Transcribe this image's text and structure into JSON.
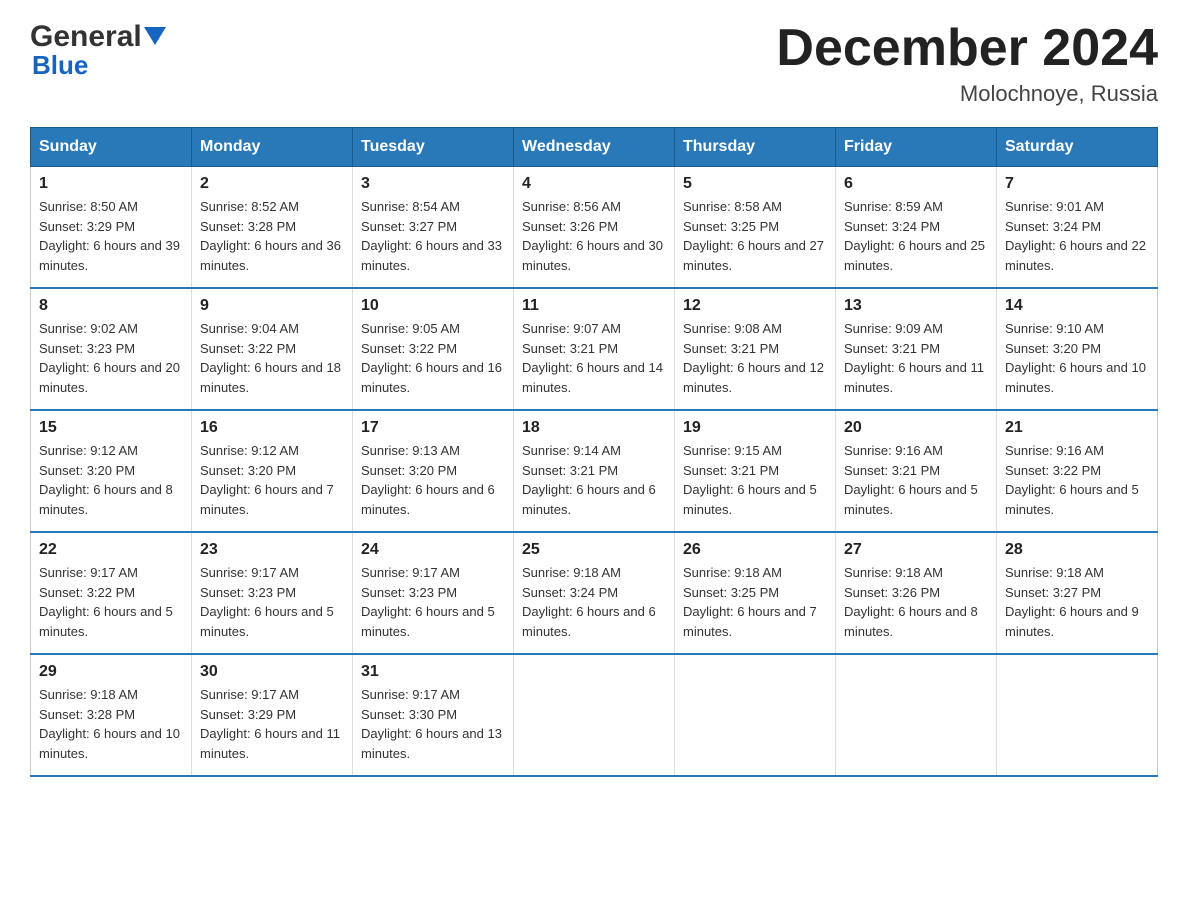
{
  "header": {
    "logo_line1": "General",
    "logo_line2": "Blue",
    "title": "December 2024",
    "subtitle": "Molochnoye, Russia"
  },
  "days_of_week": [
    "Sunday",
    "Monday",
    "Tuesday",
    "Wednesday",
    "Thursday",
    "Friday",
    "Saturday"
  ],
  "weeks": [
    [
      {
        "day": "1",
        "sunrise": "Sunrise: 8:50 AM",
        "sunset": "Sunset: 3:29 PM",
        "daylight": "Daylight: 6 hours and 39 minutes."
      },
      {
        "day": "2",
        "sunrise": "Sunrise: 8:52 AM",
        "sunset": "Sunset: 3:28 PM",
        "daylight": "Daylight: 6 hours and 36 minutes."
      },
      {
        "day": "3",
        "sunrise": "Sunrise: 8:54 AM",
        "sunset": "Sunset: 3:27 PM",
        "daylight": "Daylight: 6 hours and 33 minutes."
      },
      {
        "day": "4",
        "sunrise": "Sunrise: 8:56 AM",
        "sunset": "Sunset: 3:26 PM",
        "daylight": "Daylight: 6 hours and 30 minutes."
      },
      {
        "day": "5",
        "sunrise": "Sunrise: 8:58 AM",
        "sunset": "Sunset: 3:25 PM",
        "daylight": "Daylight: 6 hours and 27 minutes."
      },
      {
        "day": "6",
        "sunrise": "Sunrise: 8:59 AM",
        "sunset": "Sunset: 3:24 PM",
        "daylight": "Daylight: 6 hours and 25 minutes."
      },
      {
        "day": "7",
        "sunrise": "Sunrise: 9:01 AM",
        "sunset": "Sunset: 3:24 PM",
        "daylight": "Daylight: 6 hours and 22 minutes."
      }
    ],
    [
      {
        "day": "8",
        "sunrise": "Sunrise: 9:02 AM",
        "sunset": "Sunset: 3:23 PM",
        "daylight": "Daylight: 6 hours and 20 minutes."
      },
      {
        "day": "9",
        "sunrise": "Sunrise: 9:04 AM",
        "sunset": "Sunset: 3:22 PM",
        "daylight": "Daylight: 6 hours and 18 minutes."
      },
      {
        "day": "10",
        "sunrise": "Sunrise: 9:05 AM",
        "sunset": "Sunset: 3:22 PM",
        "daylight": "Daylight: 6 hours and 16 minutes."
      },
      {
        "day": "11",
        "sunrise": "Sunrise: 9:07 AM",
        "sunset": "Sunset: 3:21 PM",
        "daylight": "Daylight: 6 hours and 14 minutes."
      },
      {
        "day": "12",
        "sunrise": "Sunrise: 9:08 AM",
        "sunset": "Sunset: 3:21 PM",
        "daylight": "Daylight: 6 hours and 12 minutes."
      },
      {
        "day": "13",
        "sunrise": "Sunrise: 9:09 AM",
        "sunset": "Sunset: 3:21 PM",
        "daylight": "Daylight: 6 hours and 11 minutes."
      },
      {
        "day": "14",
        "sunrise": "Sunrise: 9:10 AM",
        "sunset": "Sunset: 3:20 PM",
        "daylight": "Daylight: 6 hours and 10 minutes."
      }
    ],
    [
      {
        "day": "15",
        "sunrise": "Sunrise: 9:12 AM",
        "sunset": "Sunset: 3:20 PM",
        "daylight": "Daylight: 6 hours and 8 minutes."
      },
      {
        "day": "16",
        "sunrise": "Sunrise: 9:12 AM",
        "sunset": "Sunset: 3:20 PM",
        "daylight": "Daylight: 6 hours and 7 minutes."
      },
      {
        "day": "17",
        "sunrise": "Sunrise: 9:13 AM",
        "sunset": "Sunset: 3:20 PM",
        "daylight": "Daylight: 6 hours and 6 minutes."
      },
      {
        "day": "18",
        "sunrise": "Sunrise: 9:14 AM",
        "sunset": "Sunset: 3:21 PM",
        "daylight": "Daylight: 6 hours and 6 minutes."
      },
      {
        "day": "19",
        "sunrise": "Sunrise: 9:15 AM",
        "sunset": "Sunset: 3:21 PM",
        "daylight": "Daylight: 6 hours and 5 minutes."
      },
      {
        "day": "20",
        "sunrise": "Sunrise: 9:16 AM",
        "sunset": "Sunset: 3:21 PM",
        "daylight": "Daylight: 6 hours and 5 minutes."
      },
      {
        "day": "21",
        "sunrise": "Sunrise: 9:16 AM",
        "sunset": "Sunset: 3:22 PM",
        "daylight": "Daylight: 6 hours and 5 minutes."
      }
    ],
    [
      {
        "day": "22",
        "sunrise": "Sunrise: 9:17 AM",
        "sunset": "Sunset: 3:22 PM",
        "daylight": "Daylight: 6 hours and 5 minutes."
      },
      {
        "day": "23",
        "sunrise": "Sunrise: 9:17 AM",
        "sunset": "Sunset: 3:23 PM",
        "daylight": "Daylight: 6 hours and 5 minutes."
      },
      {
        "day": "24",
        "sunrise": "Sunrise: 9:17 AM",
        "sunset": "Sunset: 3:23 PM",
        "daylight": "Daylight: 6 hours and 5 minutes."
      },
      {
        "day": "25",
        "sunrise": "Sunrise: 9:18 AM",
        "sunset": "Sunset: 3:24 PM",
        "daylight": "Daylight: 6 hours and 6 minutes."
      },
      {
        "day": "26",
        "sunrise": "Sunrise: 9:18 AM",
        "sunset": "Sunset: 3:25 PM",
        "daylight": "Daylight: 6 hours and 7 minutes."
      },
      {
        "day": "27",
        "sunrise": "Sunrise: 9:18 AM",
        "sunset": "Sunset: 3:26 PM",
        "daylight": "Daylight: 6 hours and 8 minutes."
      },
      {
        "day": "28",
        "sunrise": "Sunrise: 9:18 AM",
        "sunset": "Sunset: 3:27 PM",
        "daylight": "Daylight: 6 hours and 9 minutes."
      }
    ],
    [
      {
        "day": "29",
        "sunrise": "Sunrise: 9:18 AM",
        "sunset": "Sunset: 3:28 PM",
        "daylight": "Daylight: 6 hours and 10 minutes."
      },
      {
        "day": "30",
        "sunrise": "Sunrise: 9:17 AM",
        "sunset": "Sunset: 3:29 PM",
        "daylight": "Daylight: 6 hours and 11 minutes."
      },
      {
        "day": "31",
        "sunrise": "Sunrise: 9:17 AM",
        "sunset": "Sunset: 3:30 PM",
        "daylight": "Daylight: 6 hours and 13 minutes."
      },
      {
        "day": "",
        "sunrise": "",
        "sunset": "",
        "daylight": ""
      },
      {
        "day": "",
        "sunrise": "",
        "sunset": "",
        "daylight": ""
      },
      {
        "day": "",
        "sunrise": "",
        "sunset": "",
        "daylight": ""
      },
      {
        "day": "",
        "sunrise": "",
        "sunset": "",
        "daylight": ""
      }
    ]
  ]
}
